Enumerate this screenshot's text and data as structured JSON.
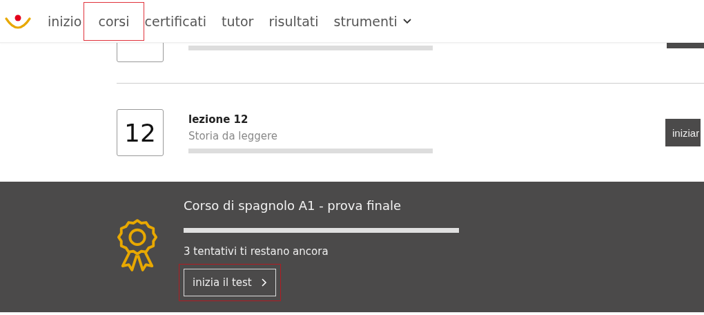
{
  "nav": {
    "items": [
      {
        "label": "inizio",
        "highlighted": false,
        "kind": "link"
      },
      {
        "label": "corsi",
        "highlighted": true,
        "kind": "link"
      },
      {
        "label": "certificati",
        "highlighted": false,
        "kind": "link"
      },
      {
        "label": "tutor",
        "highlighted": false,
        "kind": "link"
      },
      {
        "label": "risultati",
        "highlighted": false,
        "kind": "link"
      },
      {
        "label": "strumenti",
        "highlighted": false,
        "kind": "dropdown"
      }
    ]
  },
  "lessons": [
    {
      "kind": "partial"
    },
    {
      "kind": "lesson",
      "number": "12",
      "title": "lezione 12",
      "subtitle": "Storia da leggere",
      "button": "iniziar"
    }
  ],
  "final_test": {
    "title": "Corso di spagnolo A1 - prova finale",
    "attempts": "3 tentativi ti restano ancora",
    "button": {
      "label": "inizia il test",
      "highlighted": true
    }
  }
}
